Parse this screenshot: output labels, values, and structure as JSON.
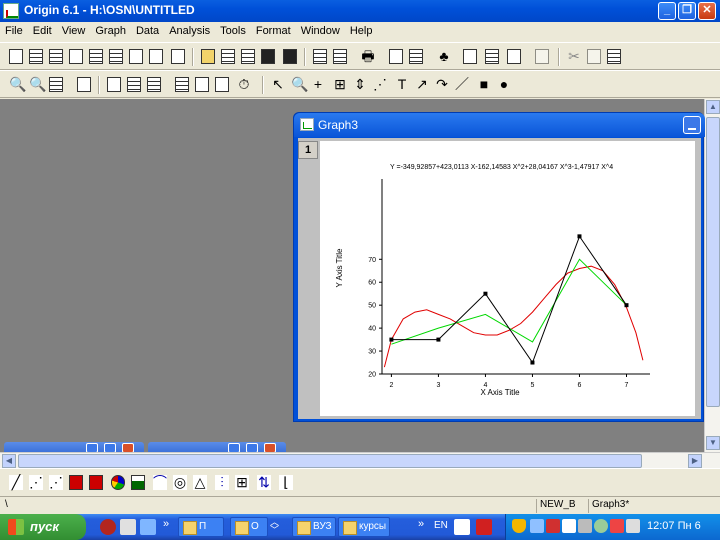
{
  "window": {
    "title": "Origin 6.1 - H:\\OSN\\UNTITLED"
  },
  "menu": [
    "File",
    "Edit",
    "View",
    "Graph",
    "Data",
    "Analysis",
    "Tools",
    "Format",
    "Window",
    "Help"
  ],
  "graph_window": {
    "title": "Graph3",
    "layer": "1"
  },
  "status": {
    "left": "\\",
    "book": "NEW_B",
    "window": "Graph3*"
  },
  "taskbar": {
    "start_label": "пуск",
    "buttons": [
      "П",
      "О",
      "ВУЗ",
      "курсы"
    ],
    "lang": "EN",
    "clock": "12:07 Пн 6"
  },
  "chart_data": {
    "type": "line",
    "annotation": "Y =-349,92857+423,0113 X-162,14583 X^2+28,04167 X^3-1,47917 X^4",
    "xlabel": "X Axis Title",
    "ylabel": "Y Axis Title",
    "xlim": [
      1.8,
      7.5
    ],
    "ylim": [
      20,
      105
    ],
    "xticks": [
      2,
      3,
      4,
      5,
      6,
      7
    ],
    "yticks": [
      20,
      30,
      40,
      50,
      60,
      70
    ],
    "ytick_labels": [
      "20",
      "30",
      "40",
      "50",
      "60",
      "70"
    ],
    "xtick_labels": [
      "2",
      "3",
      "4",
      "5",
      "6",
      "7"
    ],
    "series": [
      {
        "color": "#000000",
        "marker": "square",
        "x": [
          2,
          3,
          4,
          5,
          6,
          7
        ],
        "y": [
          35,
          35,
          55,
          25,
          80,
          50
        ]
      },
      {
        "color": "#00d800",
        "x": [
          2,
          3,
          4,
          5,
          6,
          7
        ],
        "y": [
          33,
          40,
          46,
          34,
          70,
          50
        ]
      },
      {
        "color": "#e00000",
        "x": [
          1.85,
          2,
          2.25,
          2.5,
          2.75,
          3,
          3.25,
          3.5,
          3.75,
          4,
          4.25,
          4.5,
          4.75,
          5,
          5.25,
          5.5,
          5.75,
          6,
          6.25,
          6.5,
          6.75,
          7,
          7.2,
          7.35
        ],
        "y": [
          23,
          35,
          44,
          47,
          48,
          46,
          44,
          41,
          38,
          37,
          37,
          39,
          42,
          47,
          53,
          59,
          64,
          66,
          67,
          65,
          59,
          49,
          38,
          26
        ]
      }
    ]
  }
}
